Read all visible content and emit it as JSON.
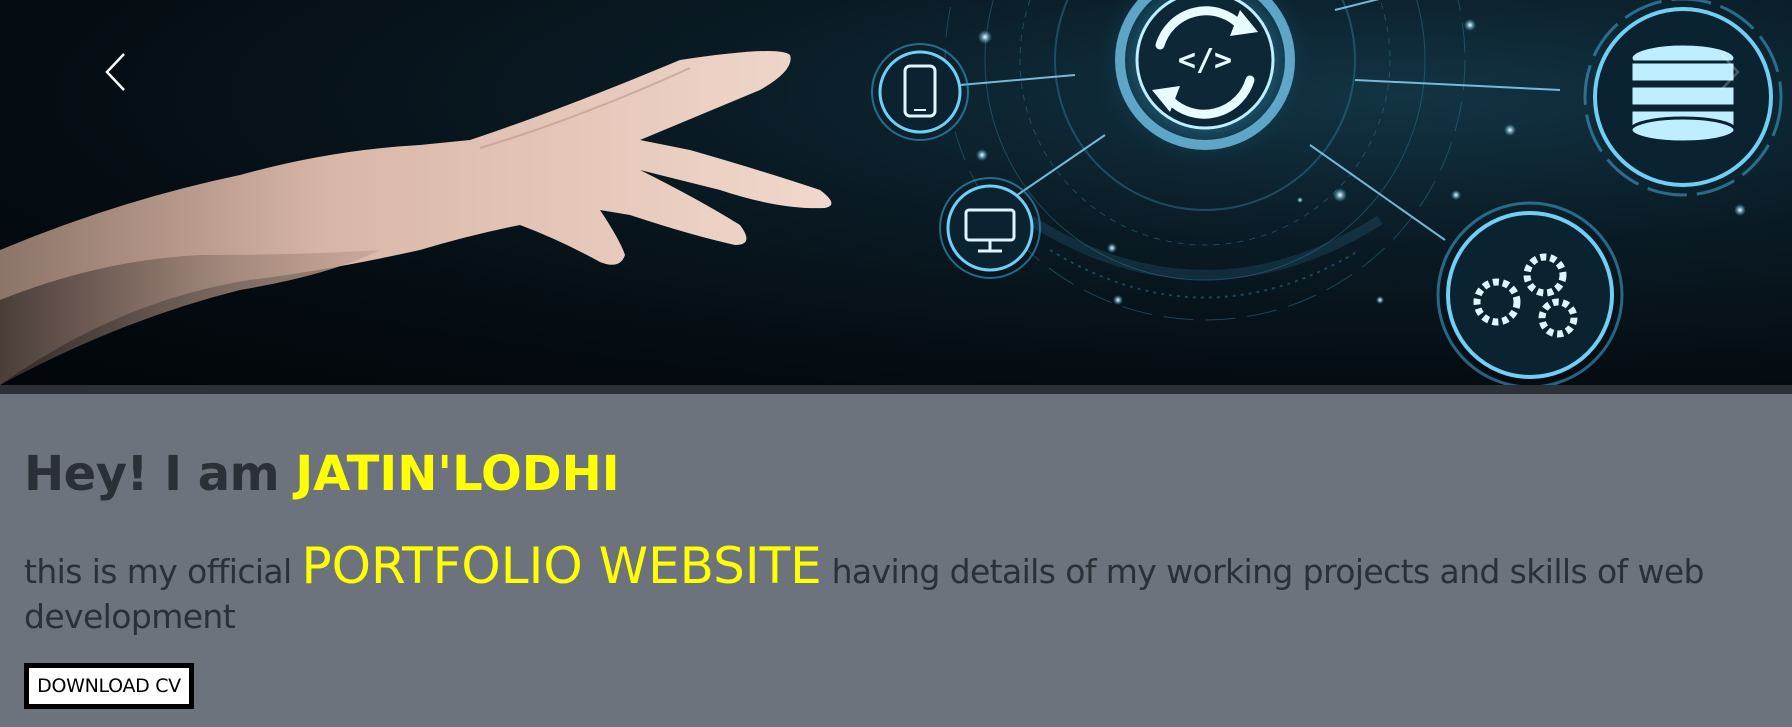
{
  "carousel": {
    "prev_icon": "chevron-left-icon",
    "next_icon": "chevron-right-icon",
    "image_description_icons": [
      "code-sync-icon",
      "smartphone-icon",
      "monitor-icon",
      "database-icon",
      "gears-icon"
    ]
  },
  "intro": {
    "greeting_prefix": "Hey! I am ",
    "name": "JATIN'LODHI",
    "tagline_prefix": "this is my official ",
    "tagline_highlight": "PORTFOLIO WEBSITE",
    "tagline_suffix": " having details of my working projects and skills of web development",
    "download_label": "DOWNLOAD CV"
  },
  "colors": {
    "background": "#6c737d",
    "accent": "#ffff00",
    "text": "#2b2f36",
    "hero_glow": "#5fc8f0"
  }
}
